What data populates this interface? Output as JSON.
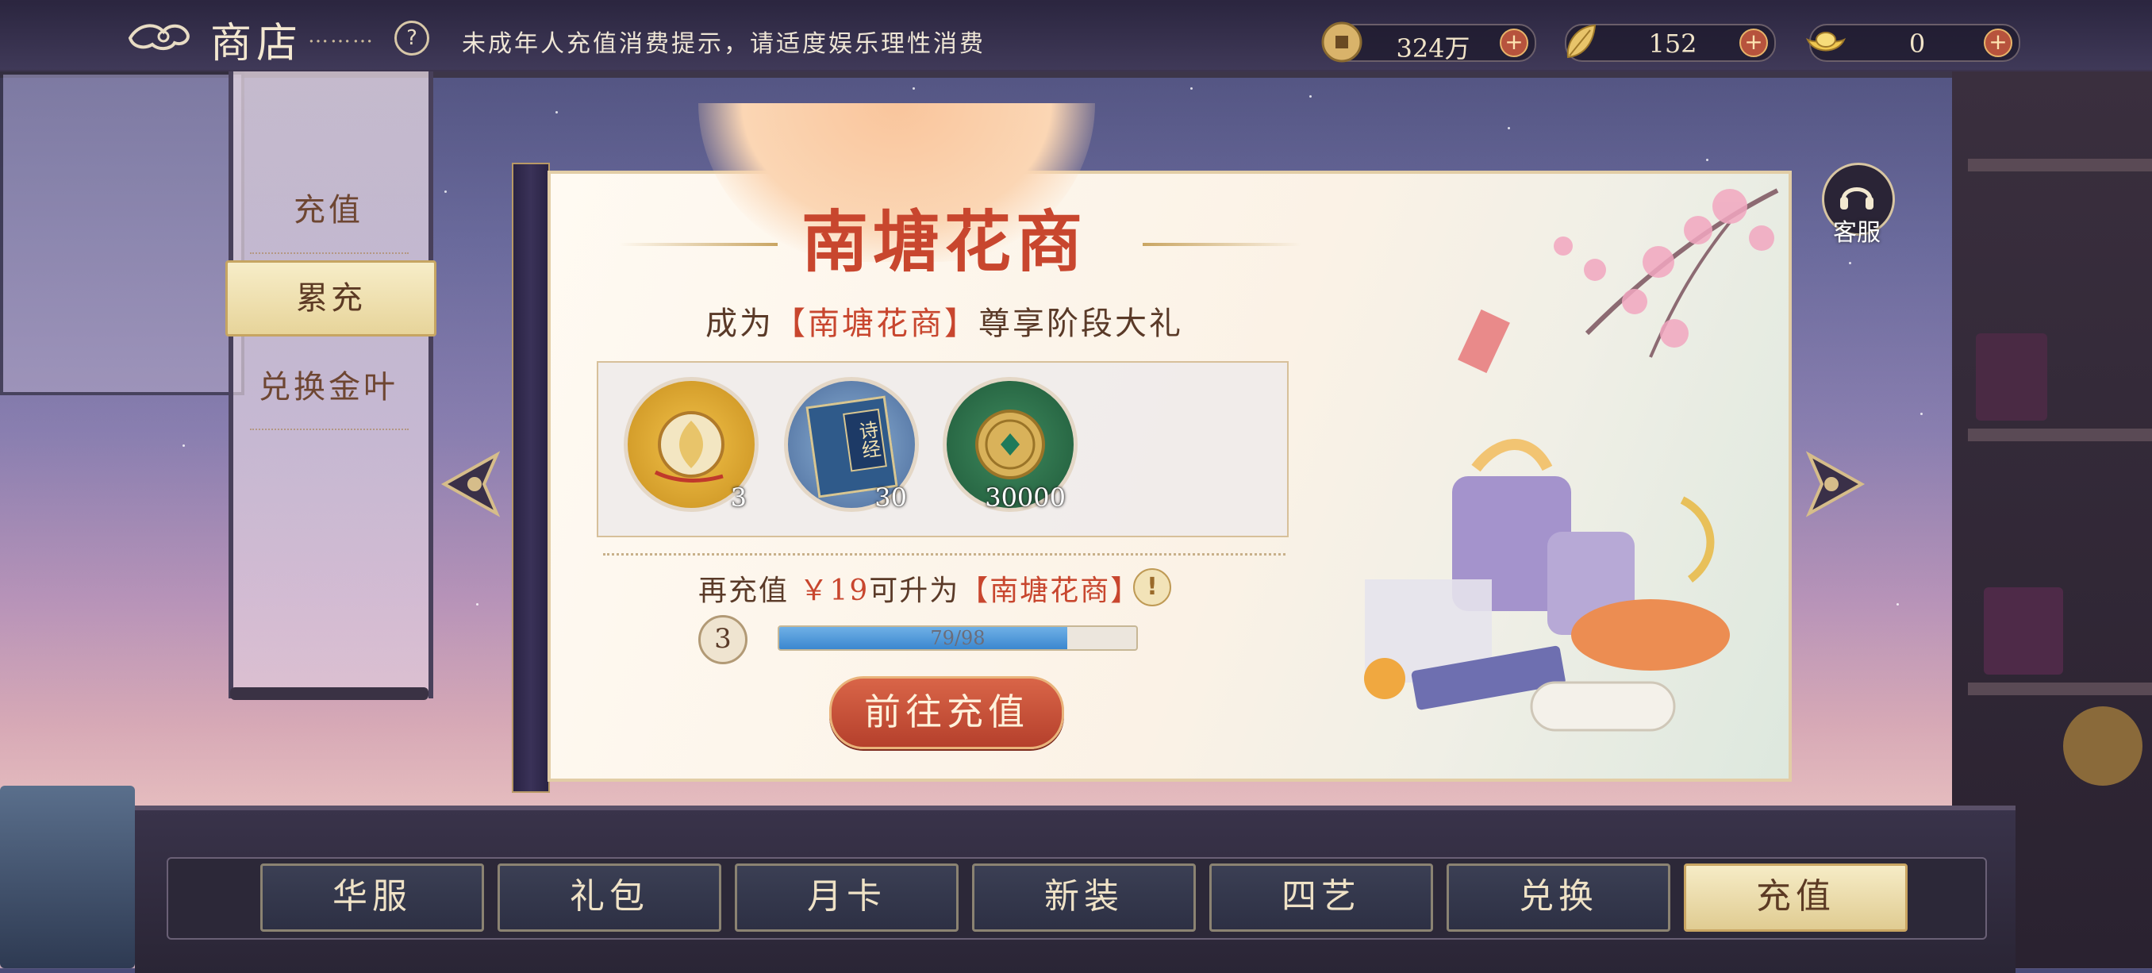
{
  "topbar": {
    "title": "商店",
    "dots": "………",
    "help": "?",
    "notice": "未成年人充值消费提示，请适度娱乐理性消费",
    "currencies": [
      {
        "icon": "copper-coin-icon",
        "value": "324万",
        "plus": "+"
      },
      {
        "icon": "gold-leaf-icon",
        "value": "152",
        "plus": "+"
      },
      {
        "icon": "gold-ingot-icon",
        "value": "0",
        "plus": "+"
      }
    ]
  },
  "sidebar": {
    "items": [
      {
        "label": "充值",
        "active": false
      },
      {
        "label": "累充",
        "active": true
      },
      {
        "label": "兑换金叶",
        "active": false
      }
    ]
  },
  "card": {
    "title": "南塘花商",
    "subtitle_prefix": "成为",
    "subtitle_highlight": "【南塘花商】",
    "subtitle_suffix": "尊享阶段大礼",
    "rewards": [
      {
        "name": "golden-pendant",
        "count": "3"
      },
      {
        "name": "poetry-book",
        "count": "30"
      },
      {
        "name": "jade-coin",
        "count": "30000"
      }
    ],
    "book_text": "诗经",
    "upgrade_prefix": "再充值",
    "upgrade_money": "￥19",
    "upgrade_mid": "可升为",
    "upgrade_highlight": "【南塘花商】",
    "info": "!",
    "level": "3",
    "progress_text": "79/98",
    "progress_value": 79,
    "progress_max": 98,
    "go_button": "前往充值"
  },
  "customer_service": {
    "label": "客服"
  },
  "bottom_tabs": [
    {
      "label": "华服",
      "active": false
    },
    {
      "label": "礼包",
      "active": false
    },
    {
      "label": "月卡",
      "active": false
    },
    {
      "label": "新装",
      "active": false
    },
    {
      "label": "四艺",
      "active": false
    },
    {
      "label": "兑换",
      "active": false
    },
    {
      "label": "充值",
      "active": true
    }
  ],
  "colors": {
    "accent_red": "#c8462e",
    "gold": "#c9a562",
    "progress_blue": "#3b87cf"
  }
}
